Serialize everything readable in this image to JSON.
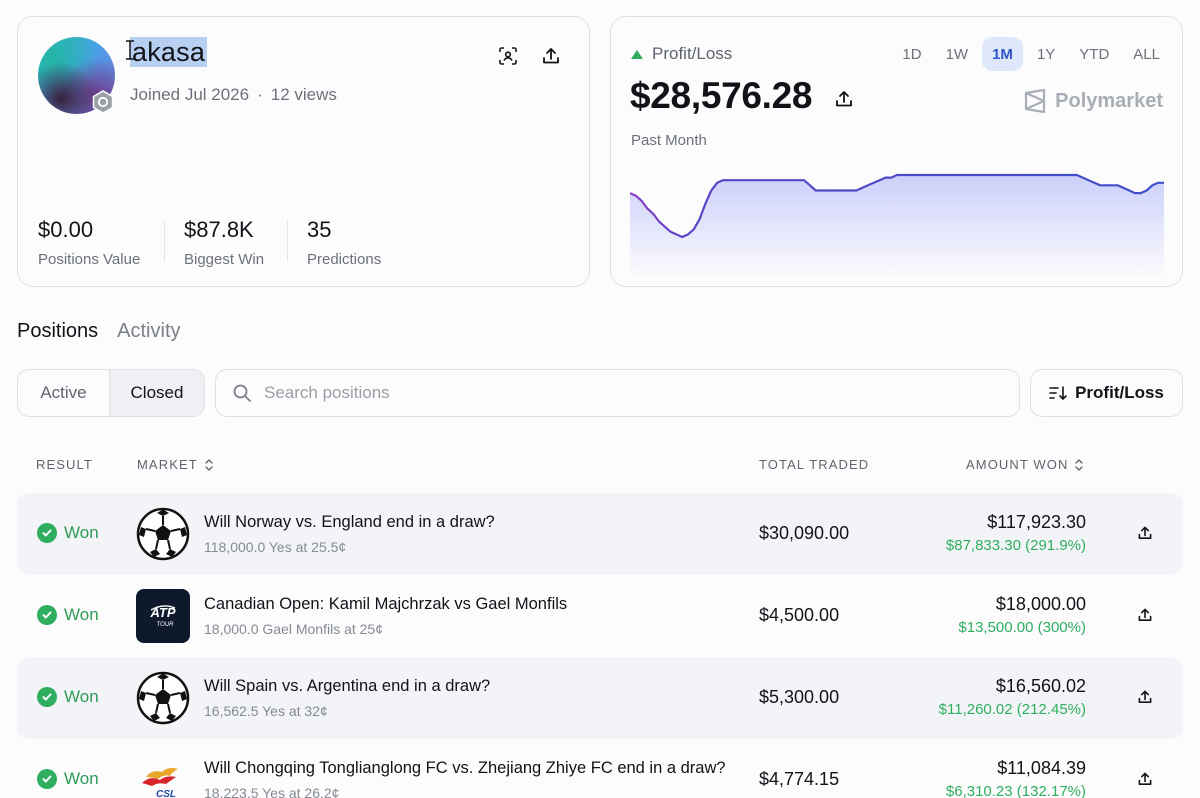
{
  "profile": {
    "username": "akasa",
    "joined": "Joined Jul 2026",
    "separator": "·",
    "views": "12 views",
    "icons": [
      "scan-icon",
      "share-icon"
    ],
    "stats": [
      {
        "value": "$0.00",
        "label": "Positions Value"
      },
      {
        "value": "$87.8K",
        "label": "Biggest Win"
      },
      {
        "value": "35",
        "label": "Predictions"
      }
    ]
  },
  "pnl": {
    "label": "Profit/Loss",
    "value": "$28,576.28",
    "period_text": "Past Month",
    "brand": "Polymarket",
    "ranges": [
      "1D",
      "1W",
      "1M",
      "1Y",
      "YTD",
      "ALL"
    ],
    "active_range": "1M",
    "colors": {
      "up": "#2fae5f",
      "line": "#4a4fc4",
      "fill_top": "#c9cdfa"
    }
  },
  "chart_data": {
    "type": "area",
    "series": [
      {
        "values": [
          41,
          42,
          44,
          47,
          49,
          52,
          54,
          56,
          57,
          58,
          57,
          55,
          51,
          45,
          40,
          37,
          36,
          36,
          36,
          36,
          36,
          36,
          36,
          36,
          36,
          36,
          36,
          36,
          36,
          36,
          36,
          38,
          40,
          40,
          40,
          40,
          40,
          40,
          40,
          40,
          39,
          38,
          37,
          36,
          35,
          35,
          34,
          34,
          34,
          34,
          34,
          34,
          34,
          34,
          34,
          34,
          34,
          34,
          34,
          34,
          34,
          34,
          34,
          34,
          34,
          34,
          34,
          34,
          34,
          34,
          34,
          34,
          34,
          34,
          34,
          34,
          34,
          34,
          35,
          36,
          37,
          38,
          38,
          38,
          38,
          39,
          40,
          41,
          41,
          40,
          38,
          37,
          37
        ]
      }
    ]
  },
  "tabs": [
    "Positions",
    "Activity"
  ],
  "filter": {
    "active": "Active",
    "closed": "Closed"
  },
  "search": {
    "placeholder": "Search positions"
  },
  "sort": {
    "label": "Profit/Loss"
  },
  "table": {
    "headers": {
      "result": "RESULT",
      "market": "MARKET",
      "traded": "TOTAL TRADED",
      "won": "AMOUNT WON"
    },
    "rows": [
      {
        "result": "Won",
        "icon": "soccer-ball-icon",
        "title": "Will Norway vs. England end in a draw?",
        "sub": "118,000.0 Yes at 25.5¢",
        "traded": "$30,090.00",
        "won": "$117,923.30",
        "pnl": "$87,833.30 (291.9%)"
      },
      {
        "result": "Won",
        "icon": "atp-tour-logo",
        "title": "Canadian Open: Kamil Majchrzak vs Gael Monfils",
        "sub": "18,000.0 Gael Monfils at 25¢",
        "traded": "$4,500.00",
        "won": "$18,000.00",
        "pnl": "$13,500.00 (300%)"
      },
      {
        "result": "Won",
        "icon": "soccer-ball-icon",
        "title": "Will Spain vs. Argentina end in a draw?",
        "sub": "16,562.5 Yes at 32¢",
        "traded": "$5,300.00",
        "won": "$16,560.02",
        "pnl": "$11,260.02 (212.45%)"
      },
      {
        "result": "Won",
        "icon": "csl-logo",
        "title": "Will Chongqing Tonglianglong FC vs. Zhejiang Zhiye FC end in a draw?",
        "sub": "18,223.5 Yes at 26.2¢",
        "traded": "$4,774.15",
        "won": "$11,084.39",
        "pnl": "$6,310.23 (132.17%)"
      }
    ]
  },
  "atp_logo_text": {
    "main": "ATP",
    "sub": "TOUR"
  },
  "csl_logo_text": "CSL"
}
